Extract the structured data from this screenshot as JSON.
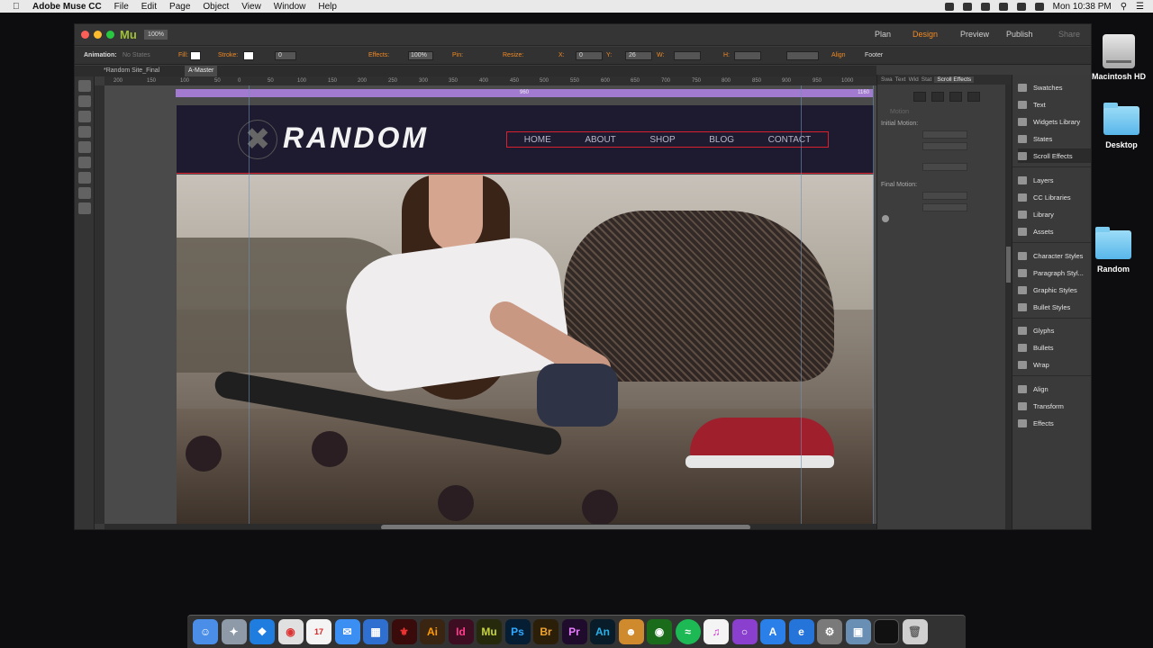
{
  "menubar": {
    "app": "Adobe Muse CC",
    "items": [
      "File",
      "Edit",
      "Page",
      "Object",
      "View",
      "Window",
      "Help"
    ],
    "clock": "Mon 10:38 PM"
  },
  "desktop": {
    "icons": [
      {
        "label": "Macintosh HD"
      },
      {
        "label": "Desktop"
      },
      {
        "label": "Random"
      }
    ]
  },
  "window": {
    "app_logo": "Mu",
    "zoom": "100%",
    "top_tabs": [
      "Plan",
      "Design",
      "Preview",
      "Publish",
      "Share"
    ],
    "active_top_tab": "Design"
  },
  "control_bar": {
    "animation_label": "Animation:",
    "animation_value": "No States",
    "fill_label": "Fill:",
    "stroke_label": "Stroke:",
    "stroke_value": "0",
    "effects_label": "Effects:",
    "effects_value": "100%",
    "pin_label": "Pin:",
    "resize_label": "Resize:",
    "x_label": "X:",
    "x_value": "0",
    "y_label": "Y:",
    "y_value": "26",
    "w_label": "W:",
    "h_label": "H:",
    "align_label": "Align",
    "footer_label": "Footer"
  },
  "doc_tabs": [
    "*Random Site_Final",
    "A-Master"
  ],
  "ruler": {
    "marks": [
      "200",
      "150",
      "100",
      "50",
      "0",
      "50",
      "100",
      "150",
      "200",
      "250",
      "300",
      "350",
      "400",
      "450",
      "500",
      "550",
      "600",
      "650",
      "700",
      "750",
      "800",
      "850",
      "900",
      "950",
      "1000"
    ]
  },
  "canvas": {
    "purple_bar_text": "960",
    "purple_bar_end": "1160",
    "site_brand": "RANDOM",
    "nav": [
      "HOME",
      "ABOUT",
      "SHOP",
      "BLOG",
      "CONTACT"
    ]
  },
  "scroll_effects_panel": {
    "tabs": [
      "Swa",
      "Text",
      "Wid",
      "Stat",
      "Scroll Effects"
    ],
    "motion_label": "Motion",
    "initial_motion": "Initial Motion:",
    "final_motion": "Final Motion:"
  },
  "right_panels": {
    "group1": [
      "Swatches",
      "Text",
      "Widgets Library",
      "States",
      "Scroll Effects"
    ],
    "group2": [
      "Layers",
      "CC Libraries",
      "Library",
      "Assets"
    ],
    "group3": [
      "Character Styles",
      "Paragraph Styl...",
      "Graphic Styles",
      "Bullet Styles"
    ],
    "group4": [
      "Glyphs",
      "Bullets",
      "Wrap"
    ],
    "group5": [
      "Align",
      "Transform",
      "Effects"
    ],
    "highlighted": "Scroll Effects"
  },
  "dock": {
    "apps": [
      "Finder",
      "Launchpad",
      "Safari",
      "Chrome",
      "Calendar",
      "Messages",
      "Files",
      "Acrobat",
      "Ai",
      "Id",
      "Mu",
      "Ps",
      "Br",
      "Pr",
      "An",
      "Cheetah",
      "Xbox",
      "Spotify",
      "iTunes",
      "Podcast",
      "App Store",
      "Edge",
      "Settings",
      "Preview",
      "Screen",
      "Trash"
    ],
    "colors": {
      "Ai": "#3a2412",
      "Id": "#3d0e22",
      "Mu": "#26290c",
      "Ps": "#061e34",
      "Br": "#2b1f0a",
      "Pr": "#1f0b2c",
      "An": "#081c2a"
    },
    "text_colors": {
      "Ai": "#ff9a00",
      "Id": "#ff3d8b",
      "Mu": "#c7d43c",
      "Ps": "#30a8ff",
      "Br": "#f0a42d",
      "Pr": "#e77cff",
      "An": "#2bb1e8"
    }
  }
}
